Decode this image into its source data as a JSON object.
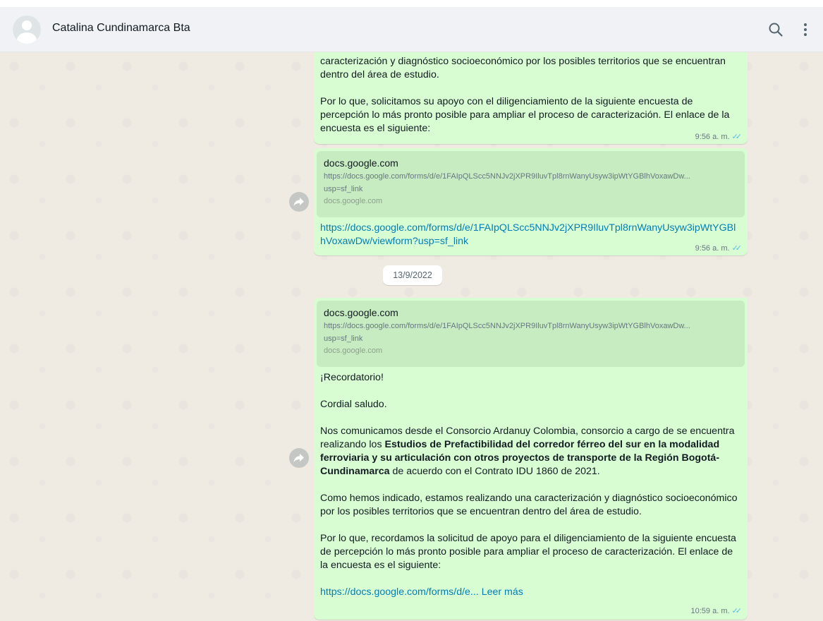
{
  "header": {
    "contact_name": "Catalina Cundinamarca Bta"
  },
  "messages": {
    "m1": {
      "p1": "caracterización y diagnóstico socioeconómico por los posibles territorios que se encuentran dentro del área de estudio.",
      "p2": "Por lo que, solicitamos su apoyo con el diligenciamiento de la siguiente encuesta de percepción lo más pronto posible para ampliar el proceso de caracterización. El enlace de la encuesta es el siguiente:",
      "time": "9:56 a. m."
    },
    "m2": {
      "preview_domain": "docs.google.com",
      "preview_url": "https://docs.google.com/forms/d/e/1FAIpQLScc5NNJv2jXPR9IluvTpl8rnWanyUsyw3ipWtYGBlhVoxawDw...",
      "preview_url2": "usp=sf_link",
      "preview_small": "docs.google.com",
      "link": "https://docs.google.com/forms/d/e/1FAIpQLScc5NNJv2jXPR9IluvTpl8rnWanyUsyw3ipWtYGBlhVoxawDw/viewform?usp=sf_link",
      "time": "9:56 a. m."
    },
    "date_separator": "13/9/2022",
    "m3": {
      "preview_domain": "docs.google.com",
      "preview_url": "https://docs.google.com/forms/d/e/1FAIpQLScc5NNJv2jXPR9IluvTpl8rnWanyUsyw3ipWtYGBlhVoxawDw...",
      "preview_url2": "usp=sf_link",
      "preview_small": "docs.google.com",
      "reminder": "¡Recordatorio!",
      "greeting": "Cordial saludo.",
      "p1_start": "Nos comunicamos desde el Consorcio Ardanuy Colombia, consorcio a cargo de se encuentra realizando los ",
      "p1_bold": "Estudios de Prefactibilidad del corredor férreo del sur en la modalidad ferroviaria y su articulación con otros proyectos de transporte de la Región Bogotá-Cundinamarca",
      "p1_end": " de acuerdo con el Contrato IDU 1860 de 2021.",
      "p2": "Como hemos indicado, estamos realizando una caracterización y diagnóstico socioeconómico por los posibles territorios que se encuentran dentro del área de estudio.",
      "p3": "Por lo que, recordamos la solicitud de apoyo para el diligenciamiento de la siguiente encuesta de percepción lo más pronto posible para ampliar el proceso de caracterización. El enlace de la encuesta es el siguiente:",
      "link_truncated": "https://docs.google.com/forms/d/e...",
      "read_more": "Leer más",
      "time": "10:59 a. m."
    }
  },
  "colors": {
    "outgoing_bubble": "#d9fdd3",
    "chat_bg": "#efeae2",
    "header_bg": "#f0f2f5",
    "link": "#027eb5",
    "read_ticks": "#53bdeb"
  },
  "icons": [
    "search-icon",
    "menu-icon",
    "forward-icon",
    "double-check-icon",
    "avatar-default-icon"
  ]
}
